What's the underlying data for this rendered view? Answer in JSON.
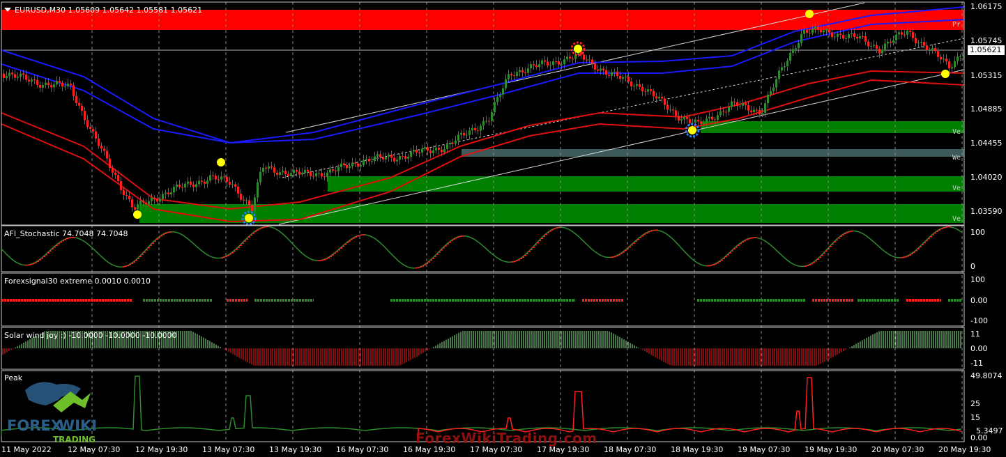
{
  "chart": {
    "symbol_line": "EURUSD,M30  1.05609 1.05642 1.05581 1.05621",
    "current_price": "1.05621",
    "price_ticks": [
      "1.06175",
      "1.05745",
      "1.05315",
      "1.04885",
      "1.04455",
      "1.04020",
      "1.03590"
    ],
    "zone_labels": [
      "Pr",
      "Ve",
      "We",
      "Ve",
      "Ve"
    ]
  },
  "indicators": {
    "stochastic": {
      "title": "AFI_Stochastic 74.7048 74.7048",
      "ticks": [
        "100",
        "0"
      ]
    },
    "forexsignal": {
      "title": "Forexsignal30 extreme 0.0010 0.0010",
      "ticks": [
        "100",
        "0.00",
        "-100"
      ]
    },
    "solar": {
      "title": "Solar wind joy :) -10.0000 -10.0000 -10.0000",
      "ticks": [
        "11",
        "0.00",
        "-11"
      ]
    },
    "peak": {
      "title": "Peak",
      "ticks": [
        "49.8074",
        "25",
        "15",
        "5.3497",
        "0.00"
      ]
    }
  },
  "time_axis": [
    "11 May 2022",
    "12 May 07:30",
    "12 May 19:30",
    "13 May 07:30",
    "13 May 19:30",
    "16 May 07:30",
    "16 May 19:30",
    "17 May 07:30",
    "17 May 19:30",
    "18 May 07:30",
    "18 May 19:30",
    "19 May 07:30",
    "19 May 19:30",
    "20 May 07:30",
    "20 May 19:30"
  ],
  "watermark": "ForexWikiTrading.com",
  "logo_text": {
    "line1": "FOREX",
    "line2": "WIKI",
    "line3": "TRADING"
  },
  "colors": {
    "bull": "#2e8b2e",
    "bear": "#ff2020",
    "blue_band": "#1a1aff",
    "red_band": "#e01010",
    "zone_red": "#ff0000",
    "zone_green": "#008000",
    "zone_gray": "#3d5a5a"
  }
}
